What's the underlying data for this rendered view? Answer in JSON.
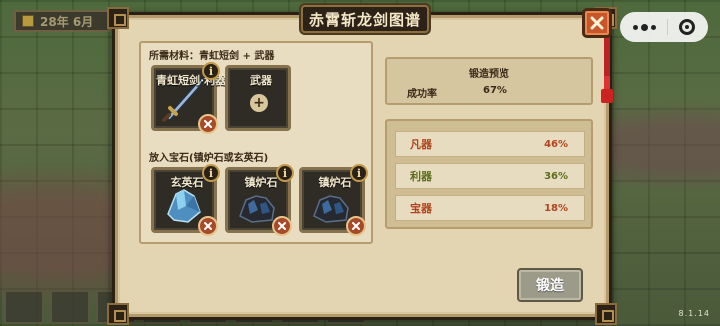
{
  "background": {
    "date_text": "28年 6月",
    "version_text": "8.1.14"
  },
  "dialog": {
    "title": "赤霄斩龙剑图谱"
  },
  "materials": {
    "label": "所需材料：",
    "required": "青虹短剑 + 武器",
    "slots": [
      {
        "label": "青虹短剑·利器",
        "icon": "sword-icon"
      },
      {
        "label": "武器",
        "icon": "plus-icon"
      }
    ]
  },
  "gems": {
    "label": "放入宝石(镇炉石或玄英石)",
    "slots": [
      {
        "label": "玄英石",
        "icon": "blue-crystal-icon"
      },
      {
        "label": "镇炉石",
        "icon": "dark-ore-icon"
      },
      {
        "label": "镇炉石",
        "icon": "dark-ore-icon"
      }
    ]
  },
  "preview": {
    "title": "锻造预览",
    "success_label": "成功率",
    "success_value": "67%"
  },
  "odds": [
    {
      "label": "凡器",
      "value": "46%",
      "color": "#b0441e"
    },
    {
      "label": "利器",
      "value": "36%",
      "color": "#5a6e1c"
    },
    {
      "label": "宝器",
      "value": "18%",
      "color": "#b0441e"
    }
  ],
  "actions": {
    "forge_label": "锻造"
  },
  "colors": {
    "close": "#c8562a",
    "panel": "#e3d5b2"
  }
}
